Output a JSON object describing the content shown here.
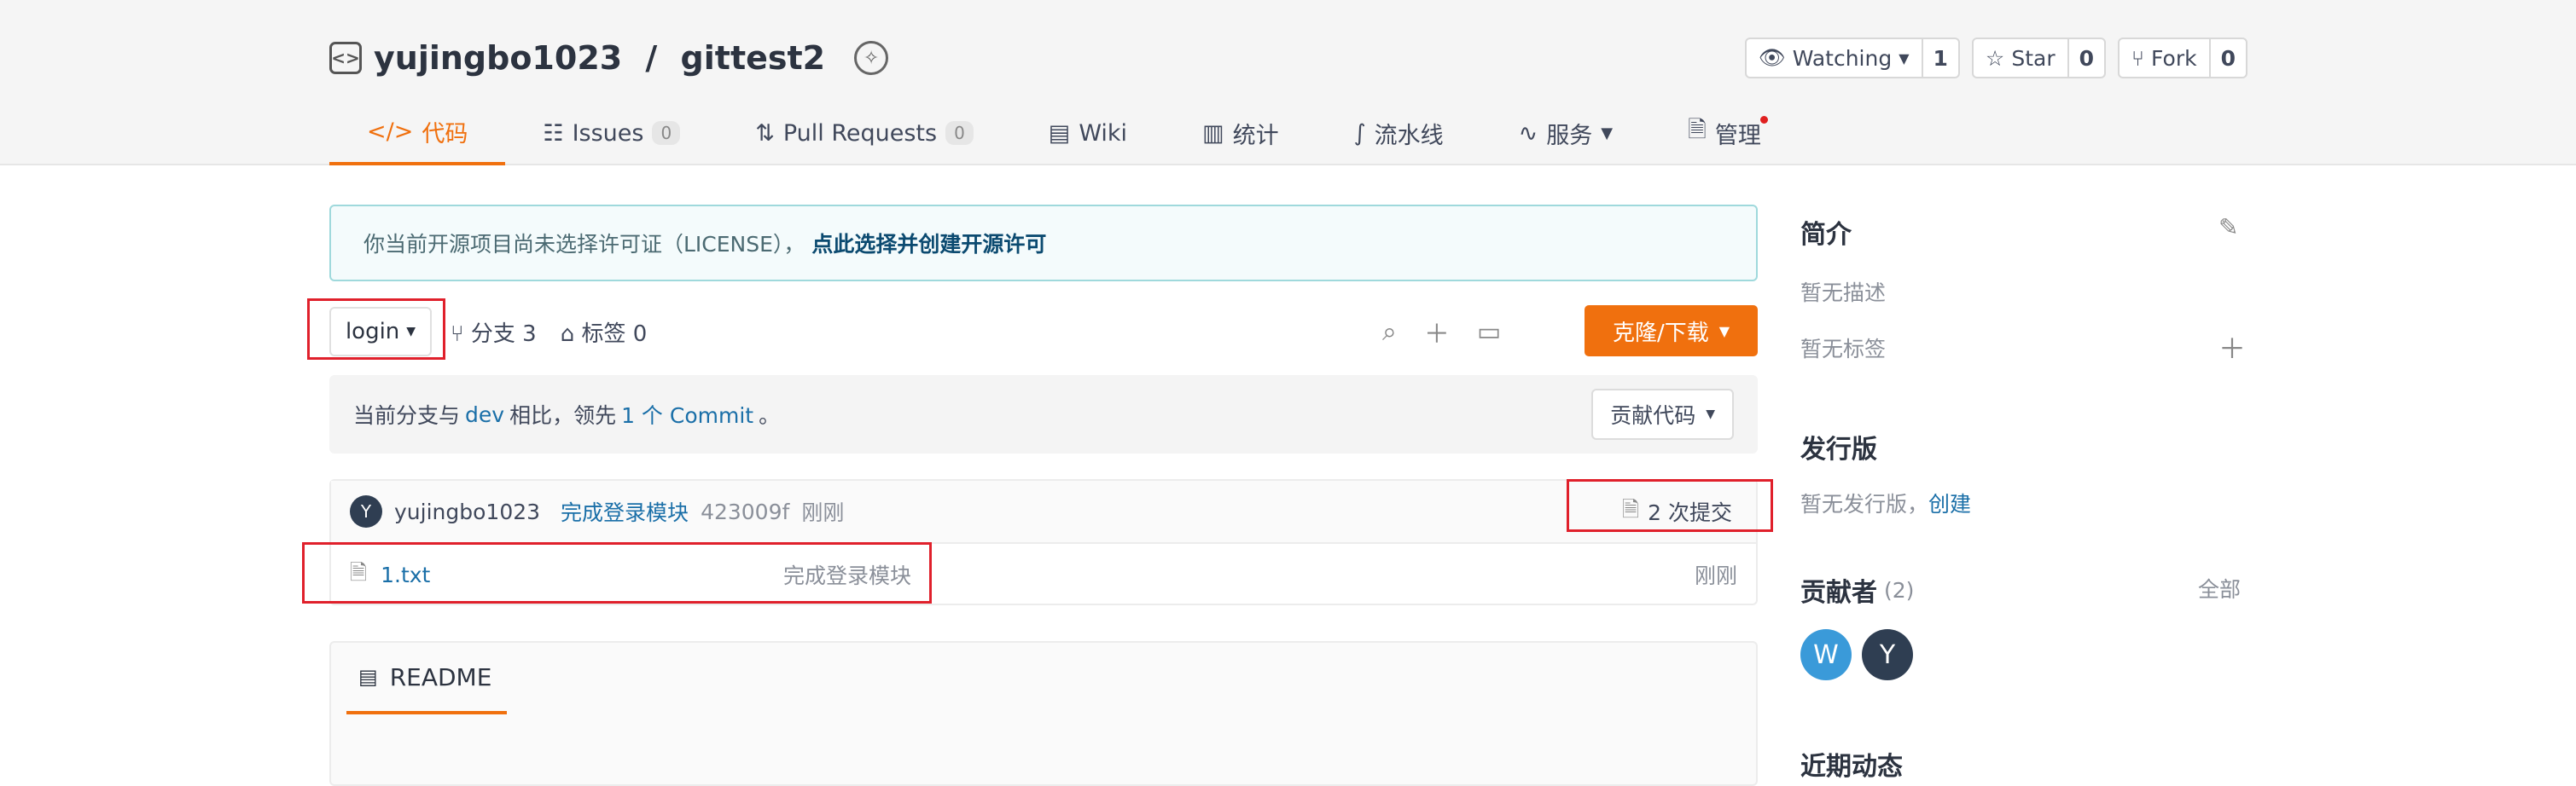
{
  "repo": {
    "owner": "yujingbo1023",
    "sep": " / ",
    "name": "gittest2"
  },
  "header_buttons": [
    {
      "label": "Watching",
      "count": "1"
    },
    {
      "label": "Star",
      "count": "0"
    },
    {
      "label": "Fork",
      "count": "0"
    }
  ],
  "tabs": [
    {
      "label": "代码",
      "active": true
    },
    {
      "label": "Issues",
      "count": "0"
    },
    {
      "label": "Pull Requests",
      "count": "0"
    },
    {
      "label": "Wiki"
    },
    {
      "label": "统计"
    },
    {
      "label": "流水线"
    },
    {
      "label": "服务"
    },
    {
      "label": "管理"
    }
  ],
  "notice": {
    "text": "你当前开源项目尚未选择许可证（LICENSE），",
    "link": "点此选择并创建开源许可"
  },
  "branch": {
    "current": "login",
    "branches_label": "分支 3",
    "tags_label": "标签 0"
  },
  "clone_label": "克隆/下载",
  "compare": {
    "prefix": "当前分支与",
    "base": "dev",
    "mid": "相比，领先",
    "ahead": "1 个 Commit",
    "suffix": "。",
    "contribute_label": "贡献代码"
  },
  "last_commit": {
    "avatar": "Y",
    "author": "yujingbo1023",
    "message": "完成登录模块",
    "hash": "423009f",
    "time": "刚刚",
    "commits_label": "2 次提交"
  },
  "files": [
    {
      "name": "1.txt",
      "message": "完成登录模块",
      "time": "刚刚"
    }
  ],
  "readme_tab": "README",
  "sidebar": {
    "intro_title": "简介",
    "no_desc": "暂无描述",
    "no_tags": "暂无标签",
    "release_title": "发行版",
    "no_release": "暂无发行版，",
    "create_link": "创建",
    "contrib_title": "贡献者",
    "contrib_count": "(2)",
    "all_link": "全部",
    "contributors": [
      {
        "initial": "W",
        "color": "#3a9ad9"
      },
      {
        "initial": "Y",
        "color": "#2f3e52"
      }
    ],
    "recent_title": "近期动态"
  },
  "colors": {
    "accent": "#f0700e",
    "link": "#1a6fa8",
    "highlight": "#e0202b"
  }
}
